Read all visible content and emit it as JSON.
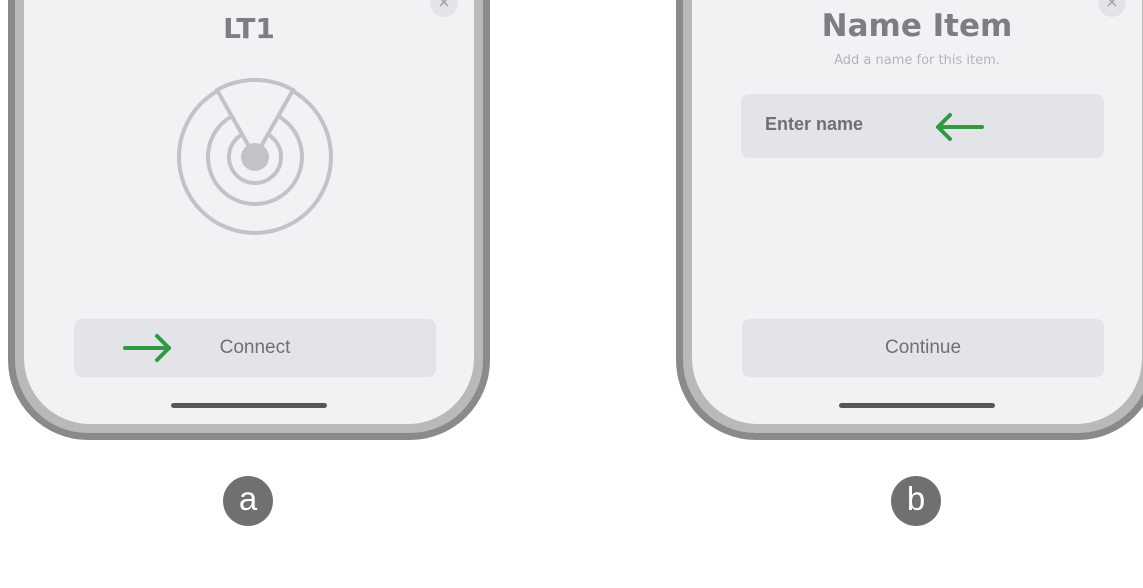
{
  "panel_a": {
    "title": "LT1",
    "connect_label": "Connect",
    "close_glyph": "×",
    "label": "a",
    "icons": [
      "close-icon",
      "radar-signal-icon",
      "arrow-right-icon"
    ],
    "colors": {
      "arrow": "#2e9a47",
      "icon": "#c2c3c6"
    }
  },
  "panel_b": {
    "title": "Name Item",
    "subtitle": "Add a name for this item.",
    "name_placeholder": "Enter name",
    "continue_label": "Continue",
    "close_glyph": "×",
    "label": "b",
    "icons": [
      "close-icon",
      "arrow-left-icon"
    ],
    "colors": {
      "arrow": "#2e9a47"
    }
  }
}
